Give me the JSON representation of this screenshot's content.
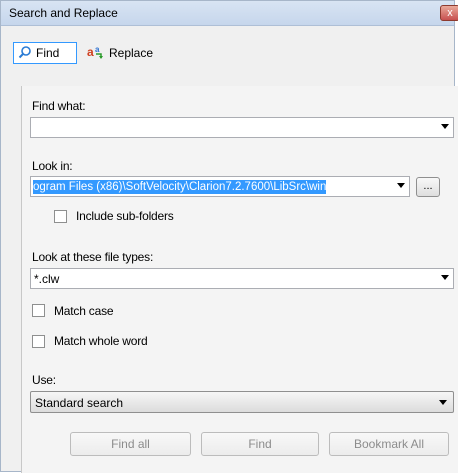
{
  "window": {
    "title": "Search and Replace",
    "close_glyph": "x"
  },
  "tabs": [
    {
      "label": "Find",
      "icon": "magnifier-icon",
      "active": true
    },
    {
      "label": "Replace",
      "icon": "replace-icon",
      "active": false
    }
  ],
  "find_what": {
    "label": "Find what:",
    "value": ""
  },
  "look_in": {
    "label": "Look in:",
    "value": "ogram Files (x86)\\SoftVelocity\\Clarion7.2.7600\\LibSrc\\win",
    "browse_label": "..."
  },
  "include_subfolders": {
    "label": "Include sub-folders",
    "checked": false
  },
  "file_types": {
    "label": "Look at these file types:",
    "value": "*.clw"
  },
  "match_case": {
    "label": "Match case",
    "checked": false
  },
  "match_whole_word": {
    "label": "Match whole word",
    "checked": false
  },
  "use": {
    "label": "Use:",
    "value": "Standard search"
  },
  "buttons": {
    "find_all": "Find all",
    "find": "Find",
    "bookmark_all": "Bookmark All"
  },
  "colors": {
    "accent": "#3399ff",
    "titlebar": "#c6d6ec",
    "disabled_text": "#8c8c8c"
  }
}
